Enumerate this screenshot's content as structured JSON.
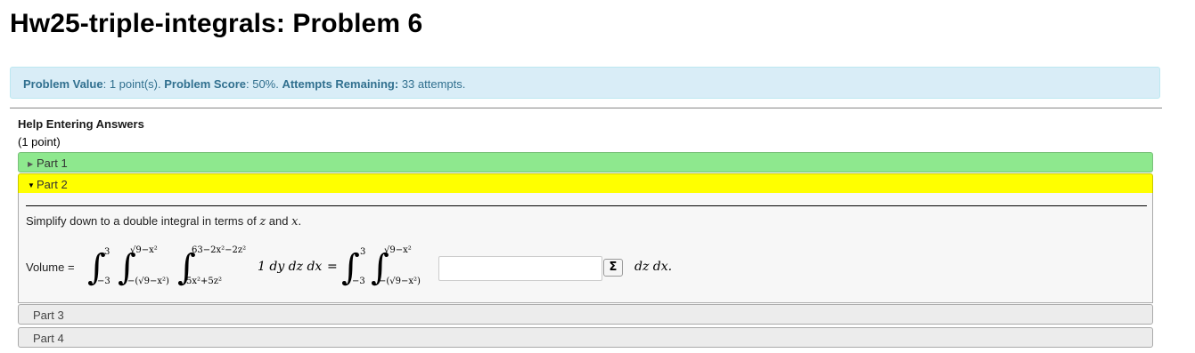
{
  "page": {
    "title": "Hw25-triple-integrals: Problem 6"
  },
  "status": {
    "value_label": "Problem Value",
    "value_text": ": 1 point(s). ",
    "score_label": "Problem Score",
    "score_text": ": 50%. ",
    "attempts_label": "Attempts Remaining:",
    "attempts_text": " 33 attempts."
  },
  "help": {
    "label": "Help Entering Answers",
    "points": "(1 point)"
  },
  "parts": [
    {
      "label": "Part 1"
    },
    {
      "label": "Part 2"
    },
    {
      "label": "Part 3"
    },
    {
      "label": "Part 4"
    }
  ],
  "part2": {
    "instruction_pre": "Simplify down to a double integral in terms of ",
    "var_z": "z",
    "instruction_and": " and ",
    "var_x": "x",
    "instruction_end": ".",
    "volume_label": "Volume =",
    "x_upper": "3",
    "x_lower": "−3",
    "z_upper": "√9−x²",
    "z_lower": "−(√9−x²)",
    "y_upper": "63−2x²−2z²",
    "y_lower": "5x²+5z²",
    "integrand": "1 dy dz dx",
    "equals": "=",
    "answer_value": "",
    "sigma_label": "Σ",
    "trailing": "dz dx."
  },
  "icons": {
    "collapsed": "triangle-right-icon",
    "expanded": "triangle-down-icon"
  }
}
